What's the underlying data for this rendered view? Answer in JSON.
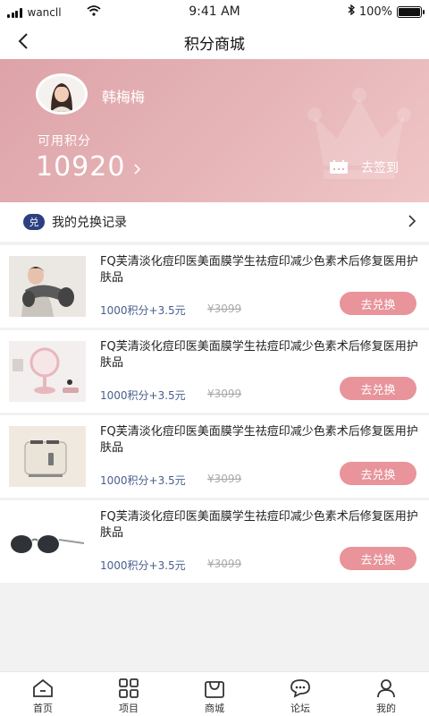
{
  "status_bar": {
    "carrier": "wancll",
    "time": "9:41 AM",
    "battery": "100%",
    "battery_level": 1.0
  },
  "nav": {
    "title": "积分商城"
  },
  "header": {
    "user_name": "韩梅梅",
    "points_label": "可用积分",
    "points_value": "10920",
    "checkin_label": "去签到"
  },
  "records": {
    "icon_text": "兑",
    "label": "我的兑换记录"
  },
  "products": [
    {
      "name": "FQ芙清淡化痘印医美面膜学生祛痘印减少色素术后修复医用护肤品",
      "price": "1000积分+3.5元",
      "original_price": "¥3099",
      "button": "去兑换",
      "image": "massager-product-image"
    },
    {
      "name": "FQ芙清淡化痘印医美面膜学生祛痘印减少色素术后修复医用护肤品",
      "price": "1000积分+3.5元",
      "original_price": "¥3099",
      "button": "去兑换",
      "image": "mirror-product-image"
    },
    {
      "name": "FQ芙清淡化痘印医美面膜学生祛痘印减少色素术后修复医用护肤品",
      "price": "1000积分+3.5元",
      "original_price": "¥3099",
      "button": "去兑换",
      "image": "toaster-product-image"
    },
    {
      "name": "FQ芙清淡化痘印医美面膜学生祛痘印减少色素术后修复医用护肤品",
      "price": "1000积分+3.5元",
      "original_price": "¥3099",
      "button": "去兑换",
      "image": "sunglasses-product-image"
    }
  ],
  "tab_bar": [
    {
      "label": "首页",
      "icon": "home-icon"
    },
    {
      "label": "项目",
      "icon": "grid-icon"
    },
    {
      "label": "商城",
      "icon": "mall-bag-icon"
    },
    {
      "label": "论坛",
      "icon": "chat-bubble-icon"
    },
    {
      "label": "我的",
      "icon": "user-icon"
    }
  ],
  "colors": {
    "header_start": "#dda3a8",
    "header_end": "#f0c6c6",
    "button": "#e8949a",
    "price": "#4a5d8c",
    "record_icon": "#2c3f80"
  }
}
